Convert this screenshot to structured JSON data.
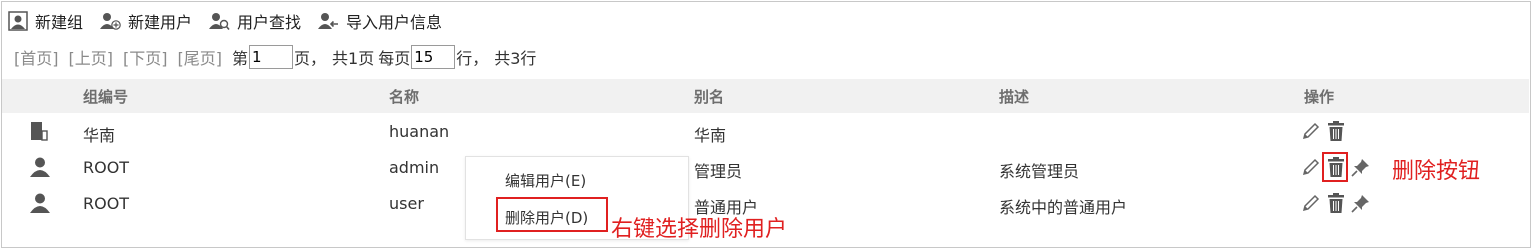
{
  "toolbar": {
    "new_group": "新建组",
    "new_user": "新建用户",
    "find_user": "用户查找",
    "import_users": "导入用户信息"
  },
  "pager": {
    "first": "[首页]",
    "prev": "[上页]",
    "next": "[下页]",
    "last": "[尾页]",
    "page_prefix": "第",
    "page_value": "1",
    "page_suffix": "页，",
    "total_pages": "共1页",
    "per_page_prefix": "每页",
    "per_page_value": "15",
    "per_page_suffix": "行，",
    "total_rows": "共3行"
  },
  "table": {
    "headers": [
      "组编号",
      "名称",
      "别名",
      "描述",
      "操作"
    ],
    "rows": [
      {
        "type": "group",
        "group_id": "华南",
        "name": "huanan",
        "alias": "华南",
        "desc": ""
      },
      {
        "type": "user",
        "group_id": "ROOT",
        "name": "admin",
        "alias": "管理员",
        "desc": "系统管理员"
      },
      {
        "type": "user",
        "group_id": "ROOT",
        "name": "user",
        "alias": "普通用户",
        "desc": "系统中的普通用户"
      }
    ]
  },
  "context_menu": {
    "items": [
      "编辑用户(E)",
      "删除用户(D)"
    ]
  },
  "annotations": {
    "delete_button_note": "删除按钮",
    "right_click_note": "右键选择删除用户"
  },
  "colors": {
    "annotation": "#e02020",
    "header_bg": "#f1f1f1",
    "icon": "#555555"
  }
}
